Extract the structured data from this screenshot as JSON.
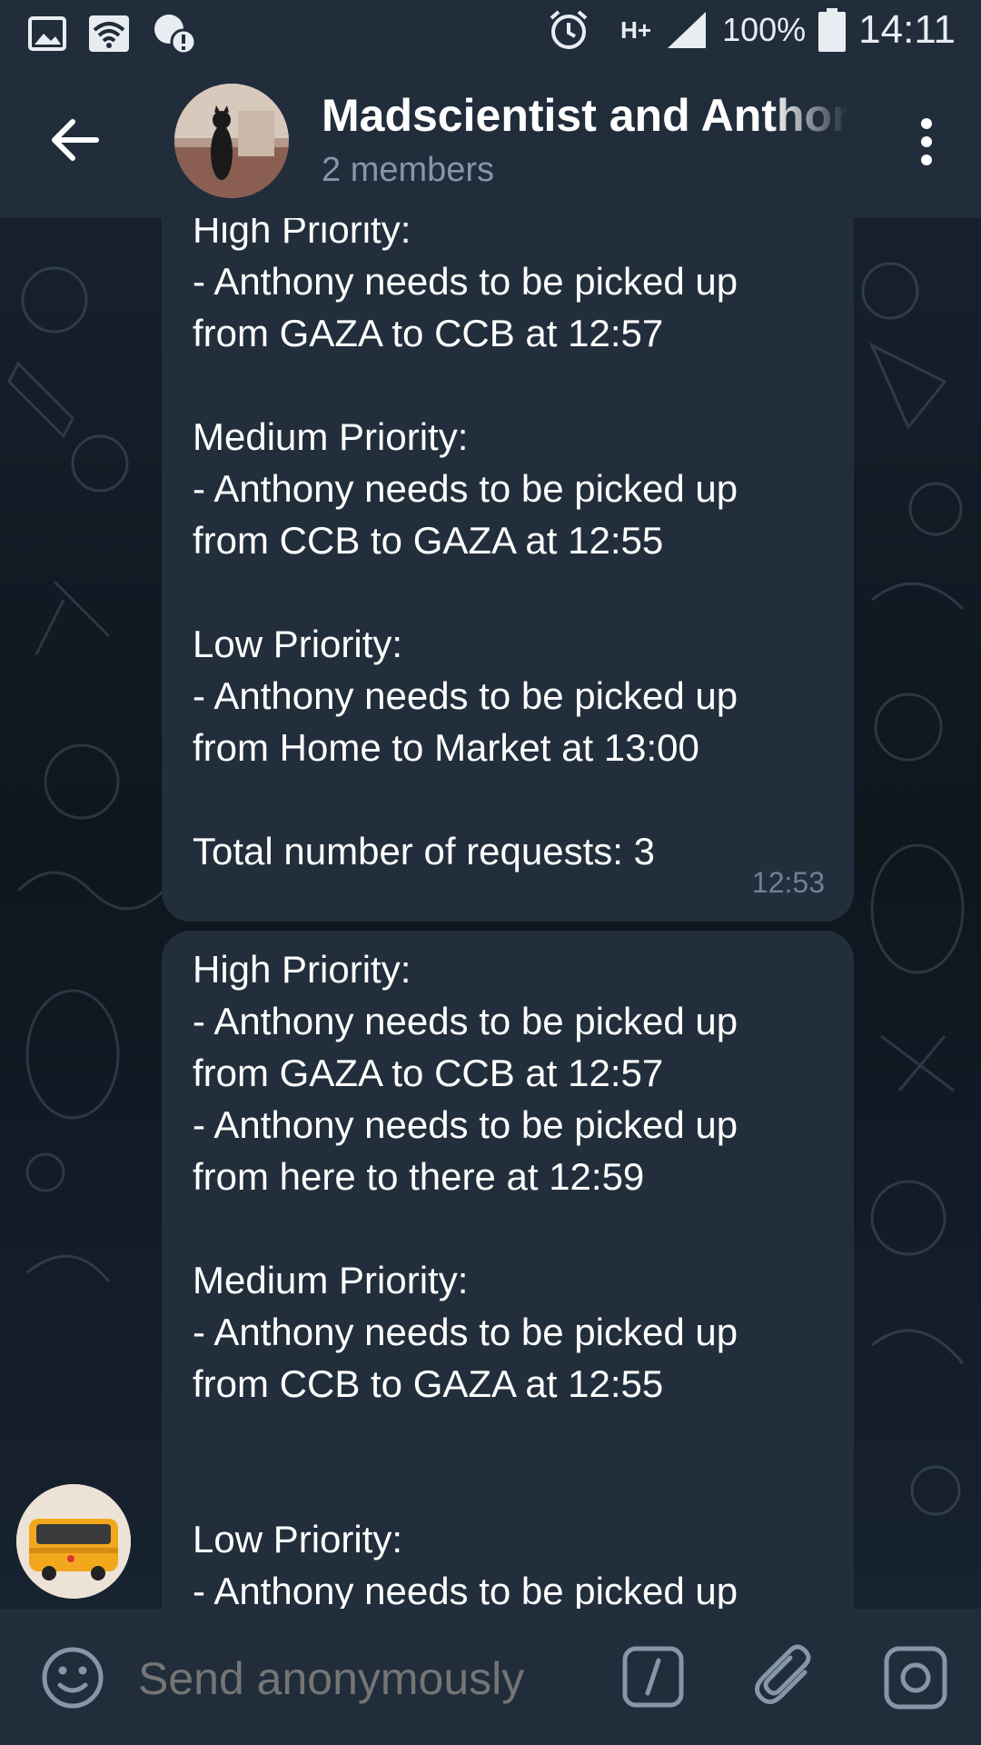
{
  "statusbar": {
    "battery": "100%",
    "time": "14:11",
    "network": "H+"
  },
  "chat": {
    "title": "Madscientist and Anthony",
    "subtitle": "2 members"
  },
  "messages": [
    {
      "text": "High Priority:\n- Anthony needs to be picked up from GAZA to CCB at 12:57\n\nMedium Priority:\n- Anthony needs to be picked up from CCB to GAZA at 12:55\n\nLow Priority:\n- Anthony needs to be picked up from Home to Market at 13:00\n\nTotal number of requests: 3",
      "time": "12:53"
    },
    {
      "text": "High Priority:\n- Anthony needs to be picked up from GAZA to CCB at 12:57\n- Anthony needs to be picked up from here to there at 12:59\n\nMedium Priority:\n- Anthony needs to be picked up from CCB to GAZA at 12:55\n\n\nLow Priority:\n- Anthony needs to be picked up"
    }
  ],
  "input": {
    "placeholder": "Send anonymously"
  },
  "icons": {
    "back": "arrow-left-icon",
    "menu": "more-vertical-icon",
    "emoji": "smile-icon",
    "command": "slash-command-icon",
    "attach": "paperclip-icon",
    "camera": "camera-icon"
  },
  "colors": {
    "header": "#212d3b",
    "bubble": "#222e3b",
    "muted": "#8596a8"
  }
}
